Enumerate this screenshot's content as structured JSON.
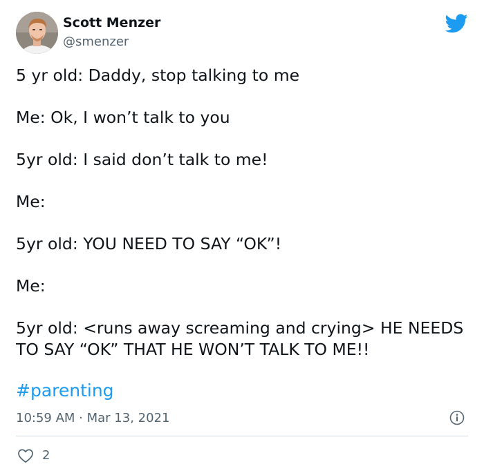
{
  "user": {
    "display_name": "Scott Menzer",
    "handle": "@smenzer",
    "avatar": "profile-photo"
  },
  "brand": {
    "icon": "twitter-bird-icon",
    "color": "#1d9bf0"
  },
  "tweet": {
    "lines": [
      "5 yr old: Daddy, stop talking to me",
      "Me: Ok, I won’t talk to you",
      "5yr old: I said don’t talk to me!",
      "Me:",
      "5yr old: YOU NEED TO SAY “OK”!",
      "Me:",
      "5yr old: <runs away screaming and crying> HE NEEDS TO SAY “OK” THAT HE WON’T TALK TO ME!!"
    ],
    "hashtag": "#parenting",
    "timestamp": "10:59 AM · Mar 13, 2021"
  },
  "actions": {
    "info_icon": "info-icon",
    "like_icon": "heart-outline-icon",
    "like_count": "2"
  },
  "colors": {
    "text": "#0f1419",
    "secondary": "#536471",
    "link": "#1d9bf0",
    "divider": "#cfd9de"
  }
}
